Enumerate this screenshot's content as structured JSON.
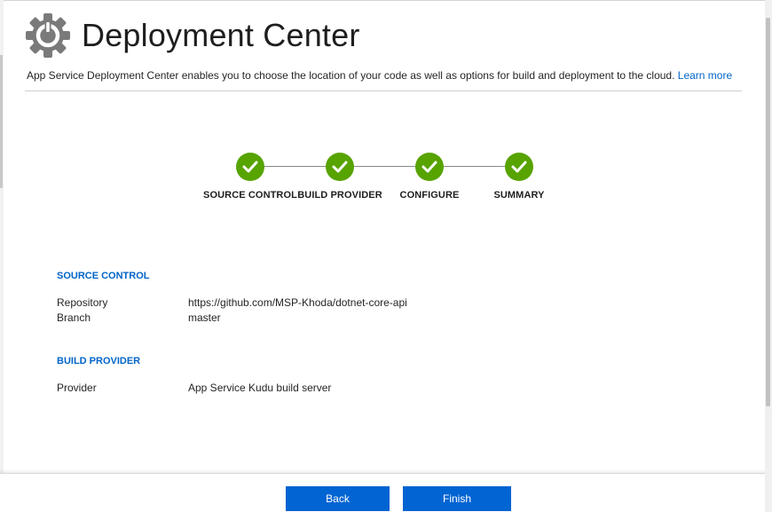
{
  "header": {
    "title": "Deployment Center",
    "icon": "gear-icon"
  },
  "description": {
    "text": "App Service Deployment Center enables you to choose the location of your code as well as options for build and deployment to the cloud. ",
    "link_label": "Learn more"
  },
  "stepper": {
    "steps": [
      {
        "label": "SOURCE CONTROL",
        "status": "complete"
      },
      {
        "label": "BUILD PROVIDER",
        "status": "complete"
      },
      {
        "label": "CONFIGURE",
        "status": "complete"
      },
      {
        "label": "SUMMARY",
        "status": "complete"
      }
    ],
    "complete_color": "#57a300"
  },
  "summary": {
    "source_control": {
      "title": "SOURCE CONTROL",
      "rows": [
        {
          "key": "Repository",
          "value": "https://github.com/MSP-Khoda/dotnet-core-api"
        },
        {
          "key": "Branch",
          "value": "master"
        }
      ]
    },
    "build_provider": {
      "title": "BUILD PROVIDER",
      "rows": [
        {
          "key": "Provider",
          "value": "App Service Kudu build server"
        }
      ]
    }
  },
  "footer": {
    "back_label": "Back",
    "finish_label": "Finish",
    "button_color": "#0064d2"
  },
  "colors": {
    "accent": "#0064c8",
    "success": "#57a300"
  }
}
